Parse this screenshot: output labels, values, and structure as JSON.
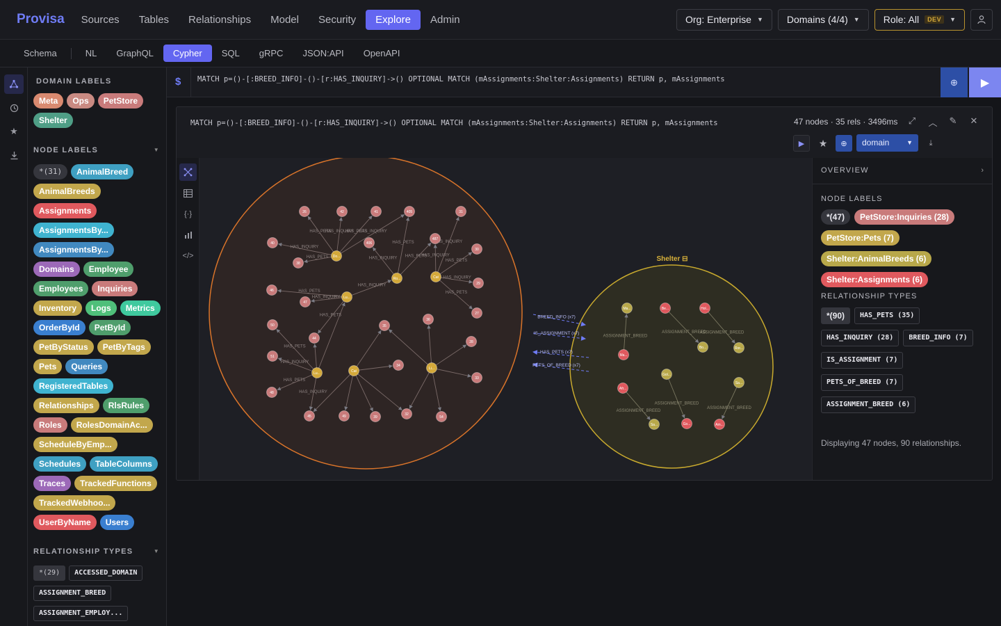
{
  "app": {
    "brand": "Provisa"
  },
  "nav": [
    {
      "label": "Sources",
      "active": false
    },
    {
      "label": "Tables",
      "active": false
    },
    {
      "label": "Relationships",
      "active": false
    },
    {
      "label": "Model",
      "active": false
    },
    {
      "label": "Security",
      "active": false
    },
    {
      "label": "Explore",
      "active": true
    },
    {
      "label": "Admin",
      "active": false
    }
  ],
  "header": {
    "org": "Org: Enterprise",
    "domains": "Domains (4/4)",
    "role": "Role: All",
    "env_badge": "DEV"
  },
  "subtabs": [
    {
      "label": "Schema",
      "active": false
    },
    {
      "label": "NL",
      "active": false
    },
    {
      "label": "GraphQL",
      "active": false
    },
    {
      "label": "Cypher",
      "active": true
    },
    {
      "label": "SQL",
      "active": false
    },
    {
      "label": "gRPC",
      "active": false
    },
    {
      "label": "JSON:API",
      "active": false
    },
    {
      "label": "OpenAPI",
      "active": false
    }
  ],
  "sidebar": {
    "domain_labels_title": "DOMAIN LABELS",
    "domain_labels": [
      {
        "label": "Meta",
        "color": "#d98a70"
      },
      {
        "label": "Ops",
        "color": "#c98a82"
      },
      {
        "label": "PetStore",
        "color": "#c97b7b"
      },
      {
        "label": "Shelter",
        "color": "#4f9e86"
      }
    ],
    "node_labels_title": "NODE LABELS",
    "node_labels_count": "*(31)",
    "node_labels": [
      {
        "label": "AnimalBreed",
        "color": "#3fa0c2"
      },
      {
        "label": "AnimalBreeds",
        "color": "#c2a74c"
      },
      {
        "label": "Assignments",
        "color": "#e0595e"
      },
      {
        "label": "AssignmentsBy...",
        "color": "#3fb3d0"
      },
      {
        "label": "AssignmentsBy...",
        "color": "#4189c0"
      },
      {
        "label": "Domains",
        "color": "#9c69b8"
      },
      {
        "label": "Employee",
        "color": "#4f9e6c"
      },
      {
        "label": "Employees",
        "color": "#4f9e6c"
      },
      {
        "label": "Inquiries",
        "color": "#c97b7b"
      },
      {
        "label": "Inventory",
        "color": "#c2a74c"
      },
      {
        "label": "Logs",
        "color": "#4fbf7a"
      },
      {
        "label": "Metrics",
        "color": "#3fc99e"
      },
      {
        "label": "OrderById",
        "color": "#3a7fd0"
      },
      {
        "label": "PetById",
        "color": "#4f9e6c"
      },
      {
        "label": "PetByStatus",
        "color": "#c2a74c"
      },
      {
        "label": "PetByTags",
        "color": "#c2a74c"
      },
      {
        "label": "Pets",
        "color": "#c2a74c"
      },
      {
        "label": "Queries",
        "color": "#4189c0"
      },
      {
        "label": "RegisteredTables",
        "color": "#3fb3d0"
      },
      {
        "label": "Relationships",
        "color": "#c2a74c"
      },
      {
        "label": "RlsRules",
        "color": "#4f9e6c"
      },
      {
        "label": "Roles",
        "color": "#c97b7b"
      },
      {
        "label": "RolesDomainAc...",
        "color": "#c2a74c"
      },
      {
        "label": "ScheduleByEmp...",
        "color": "#c2a74c"
      },
      {
        "label": "Schedules",
        "color": "#3fa0c2"
      },
      {
        "label": "TableColumns",
        "color": "#3fa0c2"
      },
      {
        "label": "Traces",
        "color": "#9c69b8"
      },
      {
        "label": "TrackedFunctions",
        "color": "#c2a74c"
      },
      {
        "label": "TrackedWebhoo...",
        "color": "#c2a74c"
      },
      {
        "label": "UserByName",
        "color": "#e0595e"
      },
      {
        "label": "Users",
        "color": "#3a7fd0"
      }
    ],
    "rel_types_title": "RELATIONSHIP TYPES",
    "rel_types_count": "*(29)",
    "rel_types": [
      "ACCESSED_DOMAIN",
      "ASSIGNMENT_BREED",
      "ASSIGNMENT_EMPLOY..."
    ]
  },
  "query": {
    "prompt": "$",
    "text": "MATCH p=()-[:BREED_INFO]-()-[r:HAS_INQUIRY]->() OPTIONAL MATCH (mAssignments:Shelter:Assignments) RETURN p, mAssignments"
  },
  "result": {
    "query": "MATCH p=()-[:BREED_INFO]-()-[r:HAS_INQUIRY]->() OPTIONAL MATCH (mAssignments:Shelter:Assignments) RETURN p, mAssignments",
    "stats": "47 nodes · 35 rels · 3496ms",
    "view_select": "domain",
    "overview": {
      "title": "OVERVIEW",
      "node_labels_title": "NODE LABELS",
      "node_labels": [
        {
          "label": "*(47)",
          "color": "#35363d"
        },
        {
          "label": "PetStore:Inquiries (28)",
          "color": "#c97b7b"
        },
        {
          "label": "PetStore:Pets (7)",
          "color": "#c2a74c"
        },
        {
          "label": "Shelter:AnimalBreeds (6)",
          "color": "#b8a84a"
        },
        {
          "label": "Shelter:Assignments (6)",
          "color": "#e0595e"
        }
      ],
      "rel_types_title": "RELATIONSHIP TYPES",
      "rel_types": [
        "*(90)",
        "HAS_PETS (35)",
        "HAS_INQUIRY (28)",
        "BREED_INFO (7)",
        "IS_ASSIGNMENT (7)",
        "PETS_OF_BREED (7)",
        "ASSIGNMENT_BREED (6)"
      ],
      "footer": "Displaying 47 nodes, 90 relationships."
    }
  },
  "graph": {
    "shelter_label": "Shelter ⊟",
    "cross_edges": [
      {
        "label": "BREED_INFO (x7)"
      },
      {
        "label": "IS_ASSIGNMENT (x7)"
      },
      {
        "label": "HAS_PETS (x7)"
      },
      {
        "label": "PETS_OF_BREED (x7)"
      }
    ],
    "petstore_nodes": [
      {
        "t": "26"
      },
      {
        "t": "42"
      },
      {
        "t": "41"
      },
      {
        "t": "405"
      },
      {
        "t": "31"
      },
      {
        "t": "40"
      },
      {
        "t": "Do..."
      },
      {
        "t": "406"
      },
      {
        "t": "487"
      },
      {
        "t": "30"
      },
      {
        "t": "38"
      },
      {
        "t": "Ro..."
      },
      {
        "t": "Cat"
      },
      {
        "t": "29"
      },
      {
        "t": "46"
      },
      {
        "t": "Lu..."
      },
      {
        "t": "47"
      },
      {
        "t": "27"
      },
      {
        "t": "50"
      },
      {
        "t": "44"
      },
      {
        "t": "35"
      },
      {
        "t": "36"
      },
      {
        "t": "28"
      },
      {
        "t": "51"
      },
      {
        "t": "34"
      },
      {
        "t": "Lu..."
      },
      {
        "t": "Cat"
      },
      {
        "t": "Li..."
      },
      {
        "t": "33"
      },
      {
        "t": "48"
      },
      {
        "t": "45"
      },
      {
        "t": "49"
      },
      {
        "t": "39"
      },
      {
        "t": "32"
      },
      {
        "t": "54"
      }
    ],
    "shelter_nodes": [
      {
        "t": "Ma..."
      },
      {
        "t": "Be..."
      },
      {
        "t": "Hol..."
      },
      {
        "t": "Ma..."
      },
      {
        "t": "Bo..."
      },
      {
        "t": "Ror..."
      },
      {
        "t": "Gol..."
      },
      {
        "t": "Sa..."
      },
      {
        "t": "Afr..."
      },
      {
        "t": "Sa..."
      },
      {
        "t": "Go..."
      },
      {
        "t": "Am..."
      }
    ],
    "edge_labels": [
      "HAS_PETS",
      "HAS_INQUIRY",
      "HAS_PETS",
      "HAS_INQUIRY",
      "HAS_PETS",
      "HAS_INQUIRY",
      "HAS_PETS",
      "HAS_INQUIRY",
      "HAS_PETS",
      "HAS_INQUIRY",
      "HAS_PETS",
      "HAS_INQUIRY",
      "HAS_PETS",
      "HAS_INQUIRY",
      "HAS_PETS",
      "HAS_INQUIRY",
      "HAS_PETS",
      "HAS_INQUIRY",
      "HAS_PETS",
      "HAS_INQUIRY",
      "HAS_PETS",
      "HAS_INQUIRY"
    ],
    "shelter_edge_labels": [
      "ASSIGNMENT_BREED",
      "ASSIGNMENT_BREED",
      "ASSIGNMENT_BREED",
      "ASSIGNMENT_BREED",
      "ASSIGNMENT_BREED",
      "ASSIGNMENT_BREED"
    ]
  }
}
